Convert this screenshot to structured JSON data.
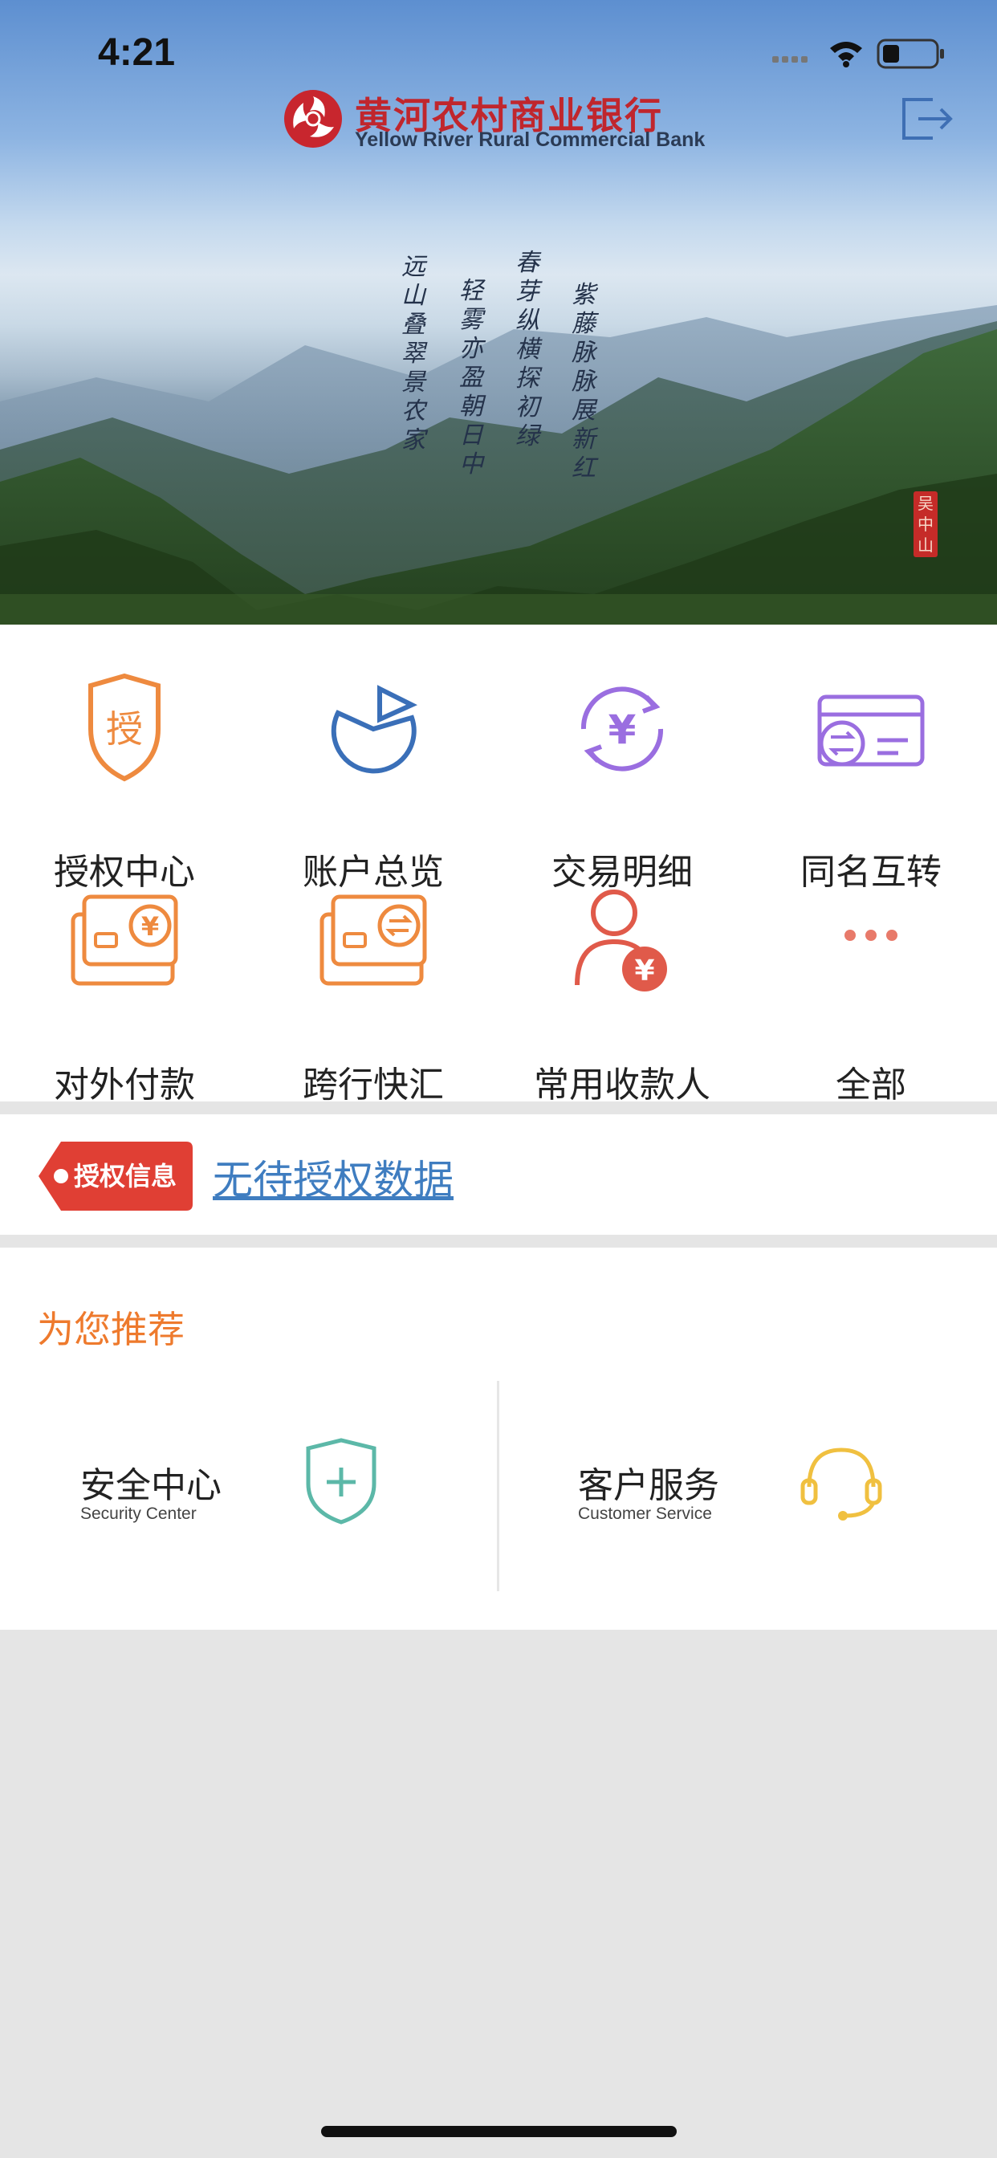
{
  "status": {
    "time": "4:21"
  },
  "header": {
    "bank_name": "黄河农村商业银行",
    "bank_name_en": "Yellow River Rural Commercial Bank",
    "logout_icon": "logout-icon"
  },
  "banner": {
    "poem_lines": [
      "远山叠翠景农家",
      "轻雾亦盈朝日中",
      "春芽纵横探初绿",
      "紫藤脉脉展新红"
    ],
    "seal": "吴中山"
  },
  "menu": {
    "items": [
      {
        "label": "授权中心",
        "icon": "authorization-shield-icon",
        "icon_text": "授"
      },
      {
        "label": "账户总览",
        "icon": "pie-chart-icon"
      },
      {
        "label": "交易明细",
        "icon": "yuan-refresh-icon",
        "icon_text": "¥"
      },
      {
        "label": "同名互转",
        "icon": "card-transfer-icon"
      },
      {
        "label": "对外付款",
        "icon": "card-yuan-icon",
        "icon_text": "¥"
      },
      {
        "label": "跨行快汇",
        "icon": "card-exchange-icon"
      },
      {
        "label": "常用收款人",
        "icon": "payee-icon",
        "icon_text": "¥"
      },
      {
        "label": "全部",
        "icon": "more-icon"
      }
    ]
  },
  "auth": {
    "tag": "授权信息",
    "message": "无待授权数据"
  },
  "recommend": {
    "title": "为您推荐",
    "cards": [
      {
        "title": "安全中心",
        "subtitle": "Security Center",
        "icon": "security-shield-icon"
      },
      {
        "title": "客户服务",
        "subtitle": "Customer Service",
        "icon": "headset-icon"
      }
    ]
  },
  "colors": {
    "accent_orange": "#ee7a2d",
    "brand_red": "#c0262d",
    "link_blue": "#3f7dc0",
    "purple": "#9a6ee0",
    "blue": "#3a6fb8",
    "teal": "#5cb8a8",
    "gold": "#f0c040"
  }
}
